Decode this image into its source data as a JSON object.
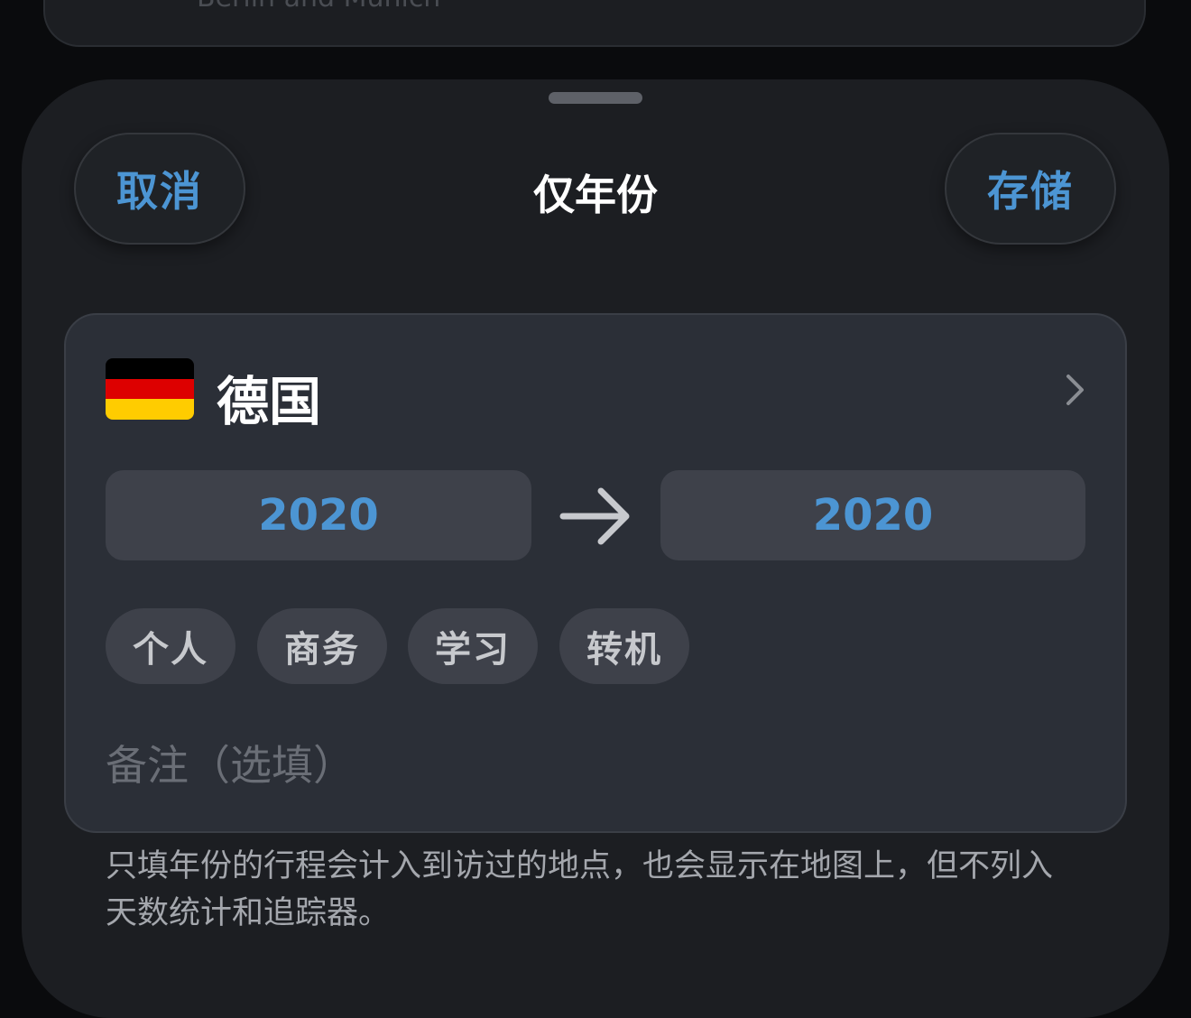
{
  "background_card": {
    "text": "Berlin and Munich"
  },
  "header": {
    "cancel_label": "取消",
    "title": "仅年份",
    "save_label": "存储"
  },
  "country": {
    "name": "德国",
    "flag_colors": [
      "#000000",
      "#dd0000",
      "#ffcc00"
    ]
  },
  "years": {
    "start": "2020",
    "end": "2020"
  },
  "categories": [
    "个人",
    "商务",
    "学习",
    "转机"
  ],
  "note_placeholder": "备注（选填）",
  "footnote": "只填年份的行程会计入到访过的地点，也会显示在地图上，但不列入天数统计和追踪器。",
  "colors": {
    "accent": "#4c95d3",
    "sheet": "#1c1e22",
    "card": "#2b2f37",
    "field": "#3e414a"
  }
}
